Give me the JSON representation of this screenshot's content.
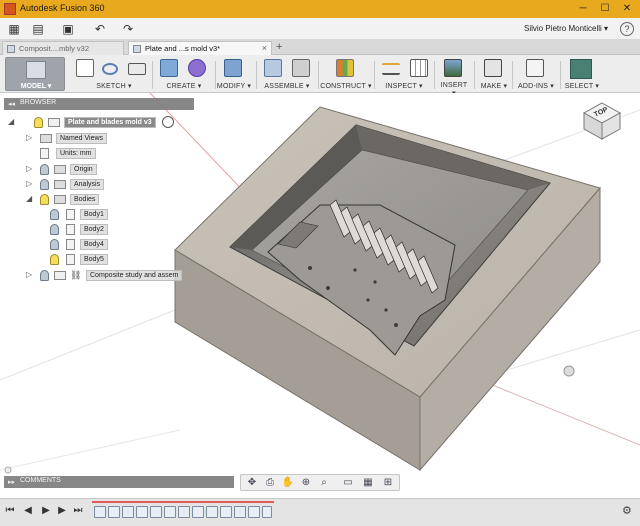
{
  "window": {
    "title": "Autodesk Fusion 360",
    "minimize": "─",
    "maximize": "☐",
    "close": "✕"
  },
  "quick_access": {
    "user": "Silvio Pietro Monticelli ▾",
    "help": "?"
  },
  "tabs": [
    {
      "label": "Composit....mbly v32",
      "active": false
    },
    {
      "label": "Plate and ...s mold v3*",
      "active": true
    }
  ],
  "toolbar": {
    "model": "MODEL ▾",
    "sketch": "SKETCH ▾",
    "create": "CREATE ▾",
    "modify": "MODIFY ▾",
    "assemble": "ASSEMBLE ▾",
    "construct": "CONSTRUCT ▾",
    "inspect": "INSPECT ▾",
    "insert": "INSERT ▾",
    "make": "MAKE ▾",
    "addins": "ADD-INS ▾",
    "select": "SELECT ▾"
  },
  "browser": {
    "header": "BROWSER",
    "root": "Plate and blades mold v3",
    "items": [
      {
        "label": "Named Views"
      },
      {
        "label": "Units: mm"
      },
      {
        "label": "Origin"
      },
      {
        "label": "Analysis"
      },
      {
        "label": "Bodies"
      },
      {
        "label": "Body1"
      },
      {
        "label": "Body2"
      },
      {
        "label": "Body4"
      },
      {
        "label": "Body5"
      },
      {
        "label": "Composite study and assem"
      }
    ]
  },
  "viewcube": {
    "face": "TOP"
  },
  "comments": {
    "header": "COMMENTS"
  }
}
